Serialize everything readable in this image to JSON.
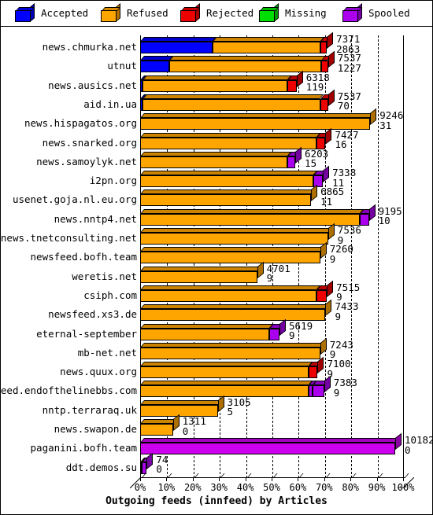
{
  "legend": {
    "items": [
      {
        "label": "Accepted",
        "color": "#0000ff",
        "icon": "cube-icon"
      },
      {
        "label": "Refused",
        "color": "#ffa500",
        "icon": "cube-icon"
      },
      {
        "label": "Rejected",
        "color": "#ee0000",
        "icon": "cube-icon"
      },
      {
        "label": "Missing",
        "color": "#00dd00",
        "icon": "cube-icon"
      },
      {
        "label": "Spooled",
        "color": "#aa00ee",
        "icon": "cube-icon"
      }
    ]
  },
  "chart_data": {
    "type": "bar",
    "orientation": "horizontal",
    "stacked": true,
    "title": "Outgoing feeds (innfeed) by Articles",
    "xlabel": "",
    "ylabel": "",
    "xlim": [
      0,
      100
    ],
    "xunit": "%",
    "grid": true,
    "legend_position": "top",
    "tick_labels": [
      "0%",
      "10%",
      "20%",
      "30%",
      "40%",
      "50%",
      "60%",
      "70%",
      "80%",
      "90%",
      "100%"
    ],
    "series_names": [
      "Accepted",
      "Refused",
      "Rejected",
      "Missing",
      "Spooled"
    ],
    "categories": [
      "news.chmurka.net",
      "utnut",
      "news.ausics.net",
      "aid.in.ua",
      "news.hispagatos.org",
      "news.snarked.org",
      "news.samoylyk.net",
      "i2pn.org",
      "usenet.goja.nl.eu.org",
      "news.nntp4.net",
      "news.tnetconsulting.net",
      "newsfeed.bofh.team",
      "weretis.net",
      "csiph.com",
      "newsfeed.xs3.de",
      "eternal-september",
      "mb-net.net",
      "news.quux.org",
      "newsfeed.endofthelinebbs.com",
      "nntp.terraraq.uk",
      "news.swapon.de",
      "paganini.bofh.team",
      "ddt.demos.su"
    ],
    "rows": [
      {
        "label": "news.chmurka.net",
        "total_pct": 71.0,
        "values": [
          "7371",
          "2863"
        ],
        "segments": [
          {
            "name": "Accepted",
            "color": "#0000ff",
            "pct": 27.5
          },
          {
            "name": "Refused",
            "color": "#ffa500",
            "pct": 41.0
          },
          {
            "name": "Rejected",
            "color": "#ee0000",
            "pct": 2.5
          }
        ]
      },
      {
        "label": "utnut",
        "total_pct": 71.5,
        "values": [
          "7537",
          "1227"
        ],
        "segments": [
          {
            "name": "Accepted",
            "color": "#0000ff",
            "pct": 11.0
          },
          {
            "name": "Refused",
            "color": "#ffa500",
            "pct": 58.0
          },
          {
            "name": "Rejected",
            "color": "#ee0000",
            "pct": 2.5
          }
        ]
      },
      {
        "label": "news.ausics.net",
        "total_pct": 59.5,
        "values": [
          "6318",
          "119"
        ],
        "segments": [
          {
            "name": "Accepted",
            "color": "#0000ff",
            "pct": 1.0
          },
          {
            "name": "Refused",
            "color": "#ffa500",
            "pct": 55.0
          },
          {
            "name": "Rejected",
            "color": "#ee0000",
            "pct": 3.5
          }
        ]
      },
      {
        "label": "aid.in.ua",
        "total_pct": 71.5,
        "values": [
          "7537",
          "70"
        ],
        "segments": [
          {
            "name": "Accepted",
            "color": "#0000ff",
            "pct": 1.0
          },
          {
            "name": "Refused",
            "color": "#ffa500",
            "pct": 67.5
          },
          {
            "name": "Rejected",
            "color": "#ee0000",
            "pct": 3.0
          }
        ]
      },
      {
        "label": "news.hispagatos.org",
        "total_pct": 87.5,
        "values": [
          "9246",
          "31"
        ],
        "segments": [
          {
            "name": "Refused",
            "color": "#ffa500",
            "pct": 87.5
          }
        ]
      },
      {
        "label": "news.snarked.org",
        "total_pct": 70.5,
        "values": [
          "7427",
          "16"
        ],
        "segments": [
          {
            "name": "Refused",
            "color": "#ffa500",
            "pct": 67.0
          },
          {
            "name": "Rejected",
            "color": "#ee0000",
            "pct": 3.5
          }
        ]
      },
      {
        "label": "news.samoylyk.net",
        "total_pct": 59.0,
        "values": [
          "6203",
          "15"
        ],
        "segments": [
          {
            "name": "Refused",
            "color": "#ffa500",
            "pct": 56.0
          },
          {
            "name": "Spooled",
            "color": "#aa00ee",
            "pct": 3.0
          }
        ]
      },
      {
        "label": "i2pn.org",
        "total_pct": 69.5,
        "values": [
          "7338",
          "11"
        ],
        "segments": [
          {
            "name": "Refused",
            "color": "#ffa500",
            "pct": 66.0
          },
          {
            "name": "Spooled",
            "color": "#aa00ee",
            "pct": 3.5
          }
        ]
      },
      {
        "label": "usenet.goja.nl.eu.org",
        "total_pct": 65.0,
        "values": [
          "6865",
          "11"
        ],
        "segments": [
          {
            "name": "Refused",
            "color": "#ffa500",
            "pct": 65.0
          }
        ]
      },
      {
        "label": "news.nntp4.net",
        "total_pct": 87.0,
        "values": [
          "9195",
          "10"
        ],
        "segments": [
          {
            "name": "Refused",
            "color": "#ffa500",
            "pct": 83.5
          },
          {
            "name": "Spooled",
            "color": "#aa00ee",
            "pct": 3.5
          }
        ]
      },
      {
        "label": "news.tnetconsulting.net",
        "total_pct": 71.5,
        "values": [
          "7536",
          "9"
        ],
        "segments": [
          {
            "name": "Refused",
            "color": "#ffa500",
            "pct": 71.5
          }
        ]
      },
      {
        "label": "newsfeed.bofh.team",
        "total_pct": 68.5,
        "values": [
          "7260",
          "9"
        ],
        "segments": [
          {
            "name": "Refused",
            "color": "#ffa500",
            "pct": 68.5
          }
        ]
      },
      {
        "label": "weretis.net",
        "total_pct": 44.5,
        "values": [
          "4701",
          "9"
        ],
        "segments": [
          {
            "name": "Refused",
            "color": "#ffa500",
            "pct": 44.5
          }
        ]
      },
      {
        "label": "csiph.com",
        "total_pct": 71.0,
        "values": [
          "7515",
          "9"
        ],
        "segments": [
          {
            "name": "Refused",
            "color": "#ffa500",
            "pct": 67.0
          },
          {
            "name": "Rejected",
            "color": "#ee0000",
            "pct": 4.0
          }
        ]
      },
      {
        "label": "newsfeed.xs3.de",
        "total_pct": 70.5,
        "values": [
          "7433",
          "9"
        ],
        "segments": [
          {
            "name": "Refused",
            "color": "#ffa500",
            "pct": 70.5
          }
        ]
      },
      {
        "label": "eternal-september",
        "total_pct": 53.0,
        "values": [
          "5619",
          "9"
        ],
        "segments": [
          {
            "name": "Refused",
            "color": "#ffa500",
            "pct": 49.0
          },
          {
            "name": "Spooled",
            "color": "#aa00ee",
            "pct": 4.0
          }
        ]
      },
      {
        "label": "mb-net.net",
        "total_pct": 68.5,
        "values": [
          "7243",
          "9"
        ],
        "segments": [
          {
            "name": "Refused",
            "color": "#ffa500",
            "pct": 68.5
          }
        ]
      },
      {
        "label": "news.quux.org",
        "total_pct": 67.5,
        "values": [
          "7100",
          "9"
        ],
        "segments": [
          {
            "name": "Refused",
            "color": "#ffa500",
            "pct": 64.0
          },
          {
            "name": "Rejected",
            "color": "#ee0000",
            "pct": 3.5
          }
        ]
      },
      {
        "label": "newsfeed.endofthelinebbs.com",
        "total_pct": 70.0,
        "values": [
          "7383",
          "9"
        ],
        "segments": [
          {
            "name": "Refused",
            "color": "#ffa500",
            "pct": 64.0
          },
          {
            "name": "Missing",
            "color": "#aa00ee",
            "pct": 1.5
          },
          {
            "name": "Spooled",
            "color": "#aa00ee",
            "pct": 4.5
          }
        ]
      },
      {
        "label": "nntp.terraraq.uk",
        "total_pct": 29.5,
        "values": [
          "3105",
          "5"
        ],
        "segments": [
          {
            "name": "Refused",
            "color": "#ffa500",
            "pct": 29.5
          }
        ]
      },
      {
        "label": "news.swapon.de",
        "total_pct": 12.5,
        "values": [
          "1311",
          "0"
        ],
        "segments": [
          {
            "name": "Refused",
            "color": "#ffa500",
            "pct": 12.5
          }
        ]
      },
      {
        "label": "paganini.bofh.team",
        "total_pct": 97.0,
        "values": [
          "10182",
          "0"
        ],
        "segments": [
          {
            "name": "Spooled",
            "color": "#cc00ee",
            "pct": 97.0
          }
        ]
      },
      {
        "label": "ddt.demos.su",
        "total_pct": 2.5,
        "values": [
          "74",
          "0"
        ],
        "segments": [
          {
            "name": "Refused",
            "color": "#ffa500",
            "pct": 0.6
          },
          {
            "name": "Spooled",
            "color": "#aa00ee",
            "pct": 1.9
          }
        ]
      }
    ]
  }
}
